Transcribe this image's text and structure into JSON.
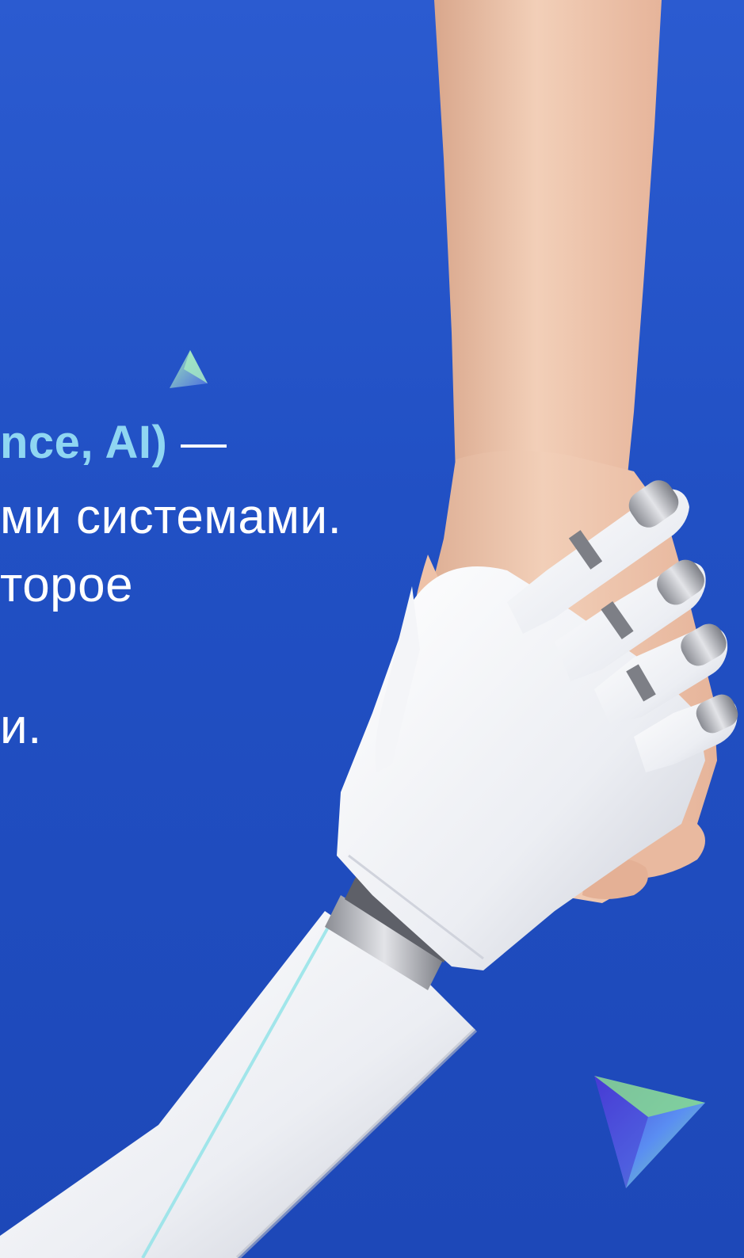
{
  "background_color": "#2150c4",
  "accent_color": "#8fd6f2",
  "text": {
    "line1_highlight": "nce, AI)",
    "line1_rest": " —",
    "line2": "ми системами.",
    "line3": "торое",
    "line4": "и."
  },
  "image": {
    "subject": "human-hand-and-robot-hand-handshake"
  },
  "decor": {
    "shapes": [
      "small-triangle-icon",
      "large-triangle-icon"
    ],
    "gradient_colors": [
      "#7fe0a5",
      "#5b8df2",
      "#4b3ed6"
    ]
  }
}
